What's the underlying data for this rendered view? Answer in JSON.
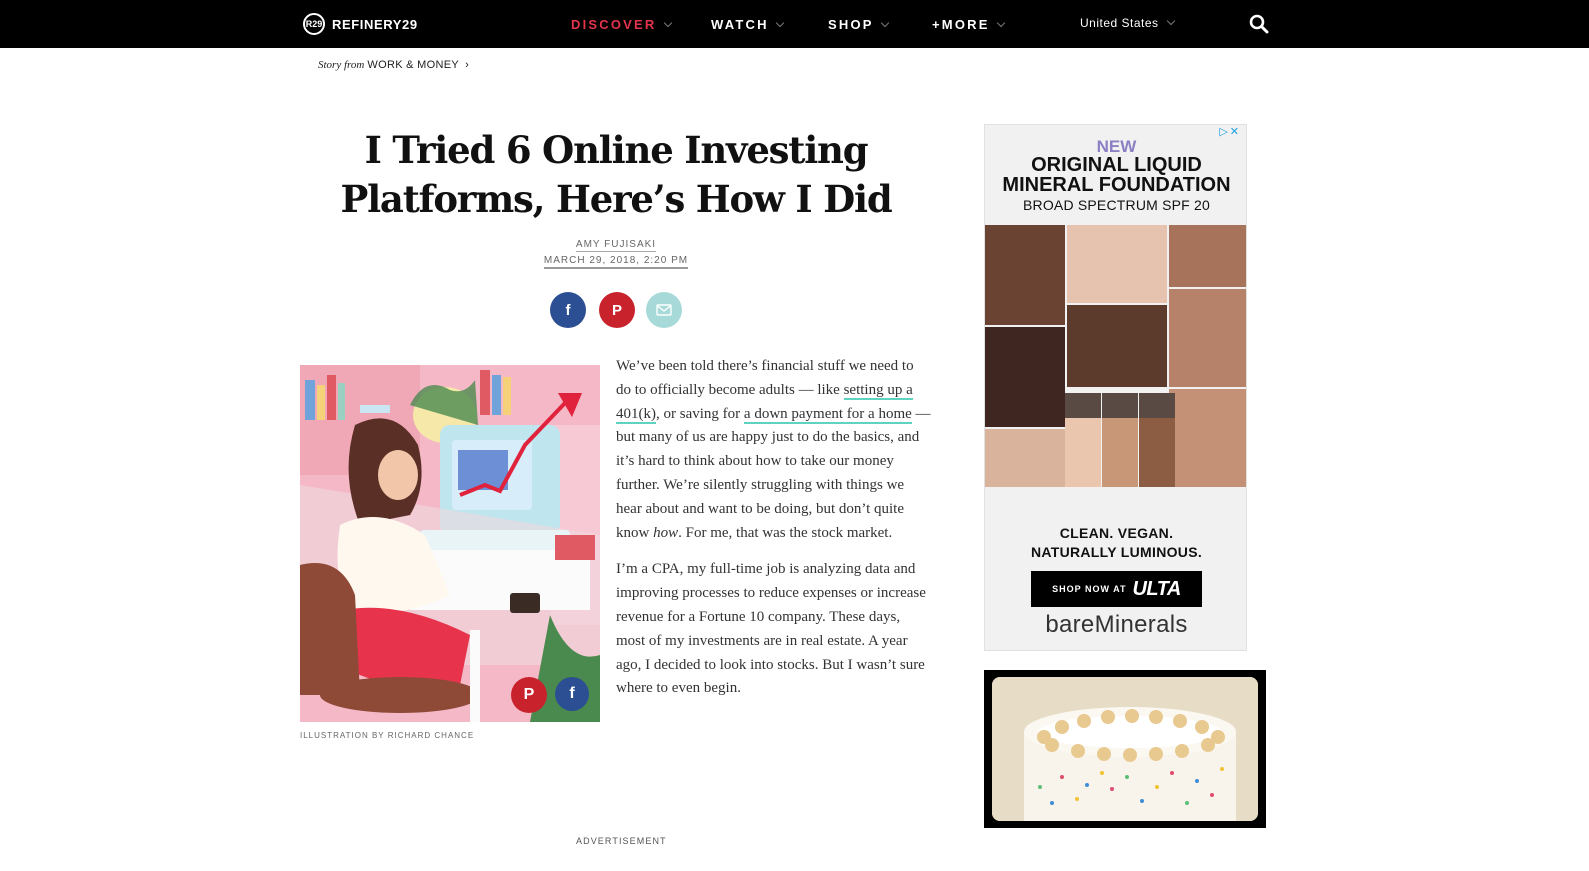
{
  "nav": {
    "logo_badge": "R29",
    "logo_text": "REFINERY29",
    "items": [
      {
        "label": "DISCOVER"
      },
      {
        "label": "WATCH"
      },
      {
        "label": "SHOP"
      },
      {
        "label": "+MORE"
      }
    ],
    "region": "United States",
    "active_color": "#e4334d"
  },
  "breadcrumb": {
    "prefix": "Story from",
    "category": "WORK & MONEY"
  },
  "article": {
    "title": "I Tried 6 Online Investing Platforms, Here’s How I Did",
    "author": "AMY FUJISAKI",
    "date": "MARCH 29, 2018, 2:20 PM",
    "image_caption": "ILLUSTRATION BY RICHARD CHANCE",
    "p1": {
      "t1": "We’ve been told there’s financial stuff we need to do to officially become adults — like ",
      "link1": "setting up a 401(k)",
      "t2": ", or saving for ",
      "link2": "a down payment for a home",
      "t3": " — but many of us are happy just to do the basics, and it’s hard to think about how to take our money further. We’re silently struggling with things we hear about and want to be doing, but don’t quite know ",
      "em": "how",
      "t4": ". For me, that was the stock market."
    },
    "p2": "I’m a CPA, my full-time job is analyzing data and improving processes to reduce expenses or increase revenue for a Fortune 10 company. These days, most of my investments are in real estate. A year ago, I decided to look into stocks. But I wasn’t sure where to even begin.",
    "advertisement_label": "ADVERTISEMENT",
    "link_underline_color": "#5dd3c0"
  },
  "ads": {
    "ad1": {
      "new": "NEW",
      "headline_1": "ORIGINAL LIQUID",
      "headline_2": "MINERAL FOUNDATION",
      "subhead": "BROAD SPECTRUM SPF 20",
      "tag_1": "CLEAN. VEGAN.",
      "tag_2": "NATURALLY LUMINOUS.",
      "cta_small": "SHOP NOW AT",
      "cta_brand": "ULTA",
      "brand": "bareMinerals"
    }
  }
}
